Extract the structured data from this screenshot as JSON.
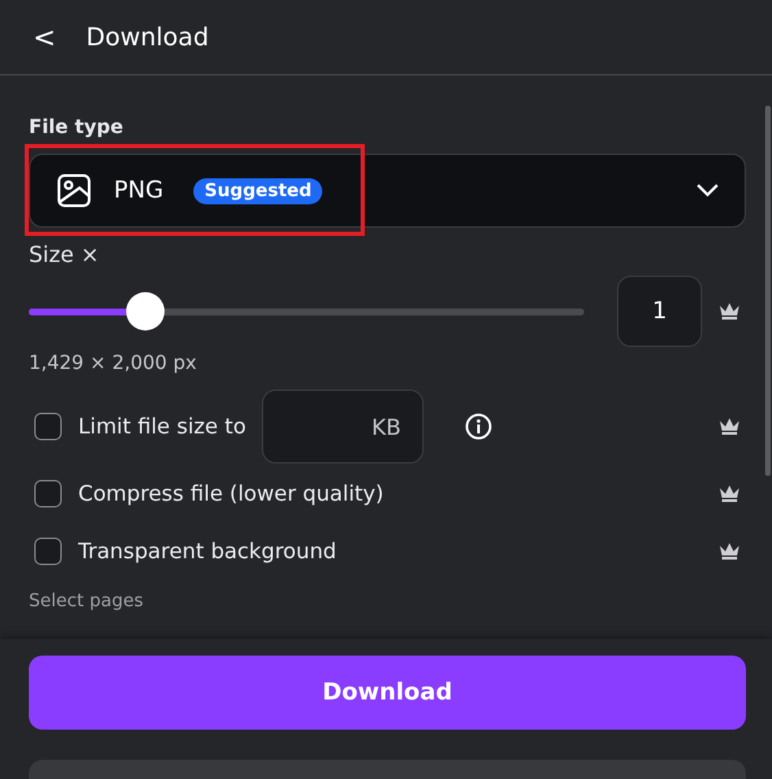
{
  "header": {
    "back_icon": "<",
    "title": "Download"
  },
  "file_type": {
    "label": "File type",
    "value": "PNG",
    "badge": "Suggested",
    "highlighted": true
  },
  "size": {
    "label": "Size ×",
    "level": 0.21,
    "value": "1",
    "premium": true,
    "dimensions": "1,429 × 2,000 px"
  },
  "options": [
    {
      "kind": "limit",
      "label": "Limit file size to",
      "checked": false,
      "unit": "KB",
      "premium": true
    },
    {
      "kind": "plain",
      "label": "Compress file (lower quality)",
      "checked": false,
      "premium": true
    },
    {
      "kind": "plain",
      "label": "Transparent background",
      "checked": false,
      "premium": true
    }
  ],
  "select_pages": {
    "label": "Select pages"
  },
  "footer": {
    "button": "Download"
  }
}
